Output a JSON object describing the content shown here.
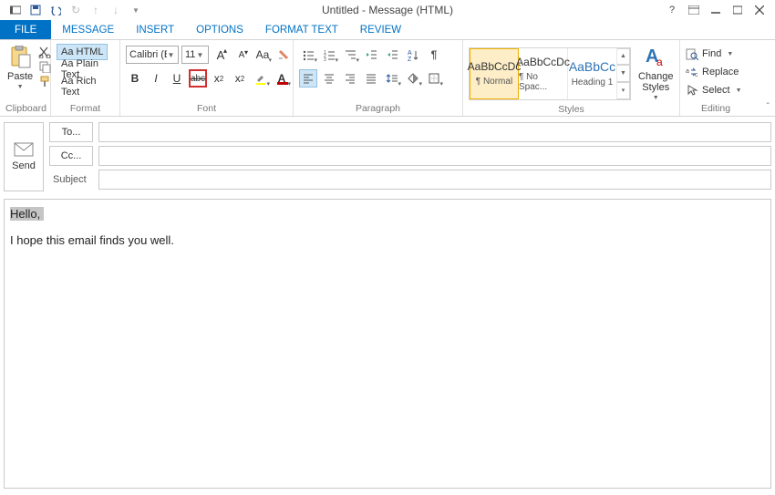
{
  "titlebar": {
    "title": "Untitled - Message (HTML)"
  },
  "tabs": {
    "file": "FILE",
    "message": "MESSAGE",
    "insert": "INSERT",
    "options": "OPTIONS",
    "formattext": "FORMAT TEXT",
    "review": "REVIEW"
  },
  "clipboard": {
    "paste": "Paste",
    "label": "Clipboard"
  },
  "format": {
    "html": "Aa HTML",
    "plain": "Aa Plain Text",
    "rich": "Aa Rich Text",
    "label": "Format"
  },
  "font": {
    "name": "Calibri (B",
    "size": "11",
    "bold": "B",
    "italic": "I",
    "underline": "U",
    "strike": "abc",
    "sub": "x",
    "sup": "x",
    "label": "Font"
  },
  "paragraph": {
    "label": "Paragraph"
  },
  "styles": {
    "preview": "AaBbCcDc",
    "preview_blue": "AaBbCc",
    "normal": "¶ Normal",
    "nospac": "¶ No Spac...",
    "heading1": "Heading 1",
    "change": "Change Styles",
    "label": "Styles"
  },
  "editing": {
    "find": "Find",
    "replace": "Replace",
    "select": "Select",
    "label": "Editing"
  },
  "compose": {
    "send": "Send",
    "to": "To...",
    "cc": "Cc...",
    "subject": "Subject",
    "to_value": "",
    "cc_value": "",
    "subject_value": ""
  },
  "body": {
    "line1": "Hello,",
    "line2": "I hope this email finds you well."
  }
}
